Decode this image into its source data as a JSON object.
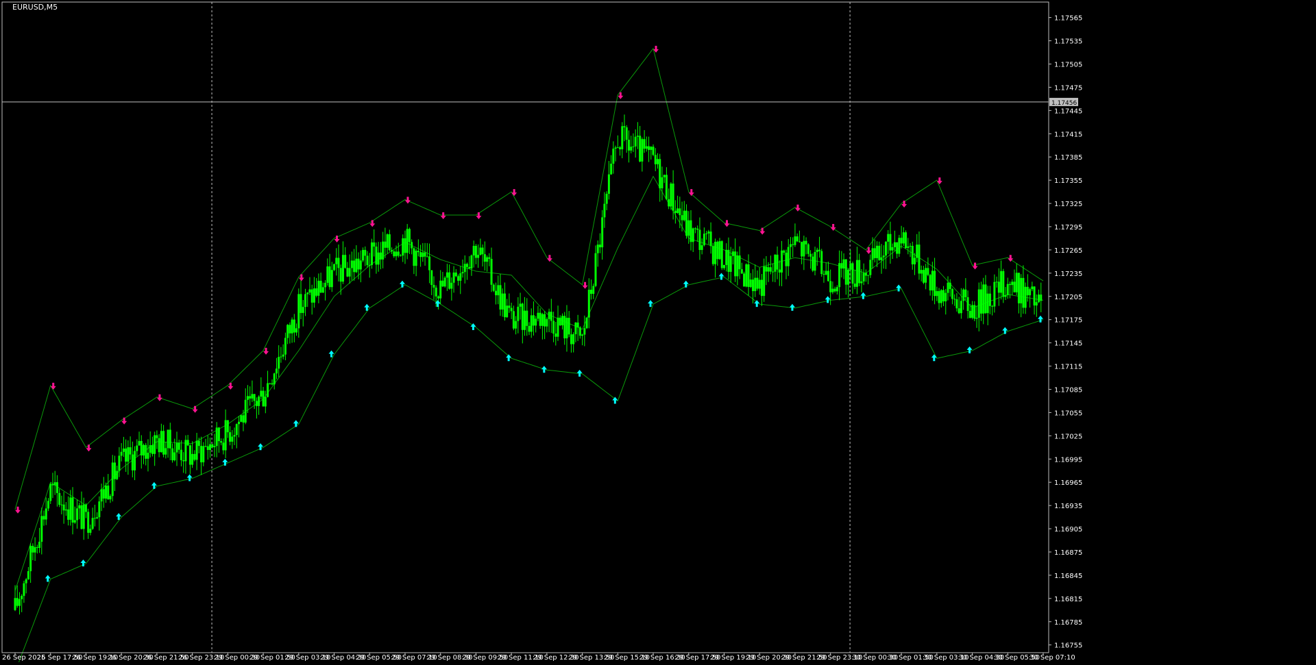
{
  "window": {
    "symbol_title": "EURUSD,M5"
  },
  "colors": {
    "background": "#000000",
    "frame": "#c0c0c0",
    "candle": "#00ff00",
    "band": "#0a9a0a",
    "buy_arrow": "#00ffff",
    "sell_arrow": "#ff1493",
    "separator": "#c0c0c0",
    "text": "#ffffff"
  },
  "chart_data": {
    "type": "candlestick",
    "symbol": "EURUSD",
    "timeframe": "M5",
    "ylim": [
      1.16745,
      1.17585
    ],
    "price_axis_ticks": [
      "1.17565",
      "1.17535",
      "1.17505",
      "1.17475",
      "1.17445",
      "1.17415",
      "1.17385",
      "1.17355",
      "1.17325",
      "1.17295",
      "1.17265",
      "1.17235",
      "1.17205",
      "1.17175",
      "1.17145",
      "1.17115",
      "1.17085",
      "1.17055",
      "1.17025",
      "1.16995",
      "1.16965",
      "1.16935",
      "1.16905",
      "1.16875",
      "1.16845",
      "1.16815",
      "1.16785",
      "1.16755"
    ],
    "current_price": "1.17456",
    "time_axis_labels": [
      "26 Sep 2025",
      "26 Sep 17:50",
      "26 Sep 19:10",
      "26 Sep 20:30",
      "26 Sep 21:50",
      "26 Sep 23:10",
      "29 Sep 00:30",
      "29 Sep 01:50",
      "29 Sep 03:10",
      "29 Sep 04:30",
      "29 Sep 05:50",
      "29 Sep 07:10",
      "29 Sep 08:30",
      "29 Sep 09:50",
      "29 Sep 11:10",
      "29 Sep 12:30",
      "29 Sep 13:50",
      "29 Sep 15:10",
      "29 Sep 16:30",
      "29 Sep 17:50",
      "29 Sep 19:10",
      "29 Sep 20:30",
      "29 Sep 21:50",
      "29 Sep 23:10",
      "30 Sep 00:30",
      "30 Sep 01:50",
      "30 Sep 03:10",
      "30 Sep 04:30",
      "30 Sep 05:50",
      "30 Sep 07:10"
    ],
    "day_separators_after": [
      "26 Sep 23:10",
      "29 Sep 23:10"
    ],
    "price_path": [
      {
        "x": "26 Sep 2025",
        "y": 1.168
      },
      {
        "x": "26 Sep 17:50",
        "y": 1.16955
      },
      {
        "x": "26 Sep 19:10",
        "y": 1.16915
      },
      {
        "x": "26 Sep 20:30",
        "y": 1.1699
      },
      {
        "x": "26 Sep 21:50",
        "y": 1.1702
      },
      {
        "x": "26 Sep 23:10",
        "y": 1.17
      },
      {
        "x": "29 Sep 00:30",
        "y": 1.1703
      },
      {
        "x": "29 Sep 01:50",
        "y": 1.1708
      },
      {
        "x": "29 Sep 03:10",
        "y": 1.1719
      },
      {
        "x": "29 Sep 04:30",
        "y": 1.17235
      },
      {
        "x": "29 Sep 05:50",
        "y": 1.17255
      },
      {
        "x": "29 Sep 07:10",
        "y": 1.1728
      },
      {
        "x": "29 Sep 08:30",
        "y": 1.17215
      },
      {
        "x": "29 Sep 09:50",
        "y": 1.1727
      },
      {
        "x": "29 Sep 11:10",
        "y": 1.17175
      },
      {
        "x": "29 Sep 12:30",
        "y": 1.1718
      },
      {
        "x": "29 Sep 13:50",
        "y": 1.1715
      },
      {
        "x": "29 Sep 15:10",
        "y": 1.1741
      },
      {
        "x": "29 Sep 16:30",
        "y": 1.1738
      },
      {
        "x": "29 Sep 17:50",
        "y": 1.1729
      },
      {
        "x": "29 Sep 19:10",
        "y": 1.17255
      },
      {
        "x": "29 Sep 20:30",
        "y": 1.1722
      },
      {
        "x": "29 Sep 21:50",
        "y": 1.17275
      },
      {
        "x": "29 Sep 23:10",
        "y": 1.1723
      },
      {
        "x": "30 Sep 00:30",
        "y": 1.1724
      },
      {
        "x": "30 Sep 01:50",
        "y": 1.17285
      },
      {
        "x": "30 Sep 03:10",
        "y": 1.17215
      },
      {
        "x": "30 Sep 04:30",
        "y": 1.1719
      },
      {
        "x": "30 Sep 05:50",
        "y": 1.17225
      },
      {
        "x": "30 Sep 07:10",
        "y": 1.1719
      }
    ],
    "band_upper": [
      1.1693,
      1.1709,
      1.1701,
      1.17045,
      1.17075,
      1.1706,
      1.1709,
      1.17135,
      1.1723,
      1.1728,
      1.173,
      1.1733,
      1.1731,
      1.1731,
      1.1734,
      1.17255,
      1.1722,
      1.17465,
      1.17525,
      1.1734,
      1.173,
      1.1729,
      1.1732,
      1.17295,
      1.17265,
      1.17325,
      1.17355,
      1.17245,
      1.17255,
      1.17225
    ],
    "band_lower": [
      1.1672,
      1.1684,
      1.1686,
      1.1692,
      1.1696,
      1.1697,
      1.1699,
      1.1701,
      1.1704,
      1.1713,
      1.1719,
      1.1722,
      1.17195,
      1.17165,
      1.17125,
      1.1711,
      1.17105,
      1.1707,
      1.17195,
      1.1722,
      1.1723,
      1.17195,
      1.1719,
      1.172,
      1.17205,
      1.17215,
      1.17125,
      1.17135,
      1.1716,
      1.17175
    ],
    "sell_arrows_x": [
      "26 Sep 2025",
      "26 Sep 17:50",
      "26 Sep 19:10",
      "26 Sep 20:30",
      "26 Sep 21:50",
      "26 Sep 23:10",
      "29 Sep 00:30",
      "29 Sep 01:50",
      "29 Sep 03:10",
      "29 Sep 04:30",
      "29 Sep 05:50",
      "29 Sep 07:10",
      "29 Sep 08:30",
      "29 Sep 09:50",
      "29 Sep 11:10",
      "29 Sep 12:30",
      "29 Sep 13:50",
      "29 Sep 15:10",
      "29 Sep 16:30",
      "29 Sep 17:50",
      "29 Sep 19:10",
      "29 Sep 20:30",
      "29 Sep 21:50",
      "29 Sep 23:10",
      "30 Sep 00:30",
      "30 Sep 01:50",
      "30 Sep 03:10",
      "30 Sep 04:30",
      "30 Sep 05:50"
    ],
    "buy_arrows_x": [
      "26 Sep 2025",
      "26 Sep 17:50",
      "26 Sep 19:10",
      "26 Sep 20:30",
      "26 Sep 21:50",
      "26 Sep 23:10",
      "29 Sep 00:30",
      "29 Sep 01:50",
      "29 Sep 03:10",
      "29 Sep 04:30",
      "29 Sep 05:50",
      "29 Sep 07:10",
      "29 Sep 08:30",
      "29 Sep 09:50",
      "29 Sep 11:10",
      "29 Sep 12:30",
      "29 Sep 13:50",
      "29 Sep 15:10",
      "29 Sep 16:30",
      "29 Sep 17:50",
      "29 Sep 19:10",
      "29 Sep 20:30",
      "29 Sep 21:50",
      "29 Sep 23:10",
      "30 Sep 00:30",
      "30 Sep 01:50",
      "30 Sep 03:10",
      "30 Sep 04:30",
      "30 Sep 05:50",
      "30 Sep 07:10"
    ]
  }
}
